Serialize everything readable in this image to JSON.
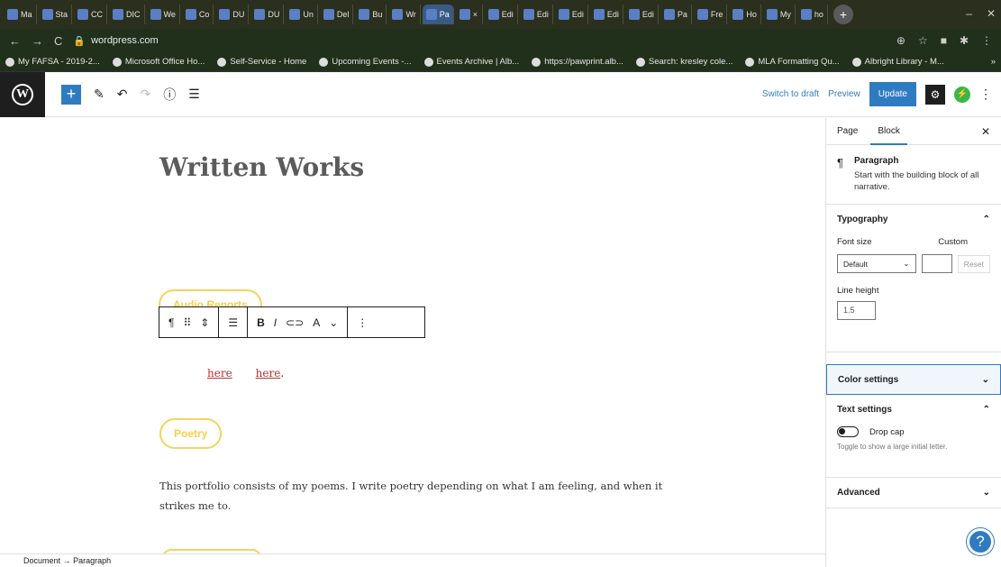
{
  "browser": {
    "tabs": [
      {
        "label": "Ma"
      },
      {
        "label": "Sta"
      },
      {
        "label": "CC"
      },
      {
        "label": "DIC"
      },
      {
        "label": "We"
      },
      {
        "label": "Co"
      },
      {
        "label": "DU"
      },
      {
        "label": "DU"
      },
      {
        "label": "Un"
      },
      {
        "label": "Del"
      },
      {
        "label": "Bu"
      },
      {
        "label": "Wr"
      },
      {
        "label": "Pa"
      },
      {
        "label": "×"
      },
      {
        "label": "Edi"
      },
      {
        "label": "Edi"
      },
      {
        "label": "Edi"
      },
      {
        "label": "Edi"
      },
      {
        "label": "Edi"
      },
      {
        "label": "Pa"
      },
      {
        "label": "Fre"
      },
      {
        "label": "Ho"
      },
      {
        "label": "My"
      },
      {
        "label": "ho"
      }
    ],
    "new_tab": "+",
    "url": "wordpress.com",
    "bookmarks": [
      "My FAFSA - 2019-2...",
      "Microsoft Office Ho...",
      "Self-Service - Home",
      "Upcoming Events -...",
      "Events Archive | Alb...",
      "https://pawprint.alb...",
      "Search: kresley cole...",
      "MLA Formatting Qu...",
      "Albright Library - M..."
    ],
    "bookmarks_overflow": "»"
  },
  "toolbar": {
    "add_block": "+",
    "switch_to_draft": "Switch to draft",
    "preview": "Preview",
    "update": "Update"
  },
  "editor": {
    "title": "Written Works",
    "pill_audio": "Audio Reports",
    "link_1": "here",
    "link_2": "here",
    "link_suffix": ".",
    "pill_poetry": "Poetry",
    "paragraph": "This portfolio consists of my poems. I write poetry depending on what I am feeling, and when it strikes me to.",
    "block_toolbar": {
      "paragraph_icon": "¶",
      "bold": "B",
      "italic": "I",
      "more_label": "A"
    }
  },
  "breadcrumb": {
    "root": "Document",
    "arrow": "→",
    "current": "Paragraph"
  },
  "sidebar": {
    "tabs": [
      "Page",
      "Block"
    ],
    "active_tab": "Block",
    "block": {
      "name": "Paragraph",
      "description": "Start with the building block of all narrative."
    },
    "typography": {
      "title": "Typography",
      "font_size_label": "Font size",
      "custom_label": "Custom",
      "font_size_value": "Default",
      "reset": "Reset",
      "line_height_label": "Line height",
      "line_height_value": "1.5"
    },
    "color_settings": "Color settings",
    "text_settings": {
      "title": "Text settings",
      "drop_cap_label": "Drop cap",
      "drop_cap_help": "Toggle to show a large initial letter."
    },
    "advanced": "Advanced"
  },
  "help": "?"
}
